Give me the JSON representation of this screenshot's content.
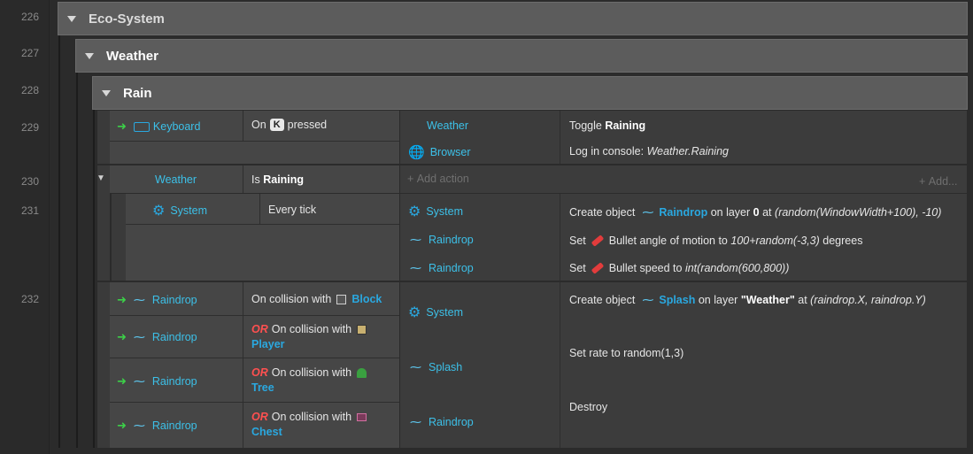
{
  "line_numbers": [
    "226",
    "227",
    "228",
    "229",
    "230",
    "231",
    "232"
  ],
  "groups": [
    {
      "name": "Eco-System"
    },
    {
      "name": "Weather"
    },
    {
      "name": "Rain"
    }
  ],
  "event229": {
    "object": "Keyboard",
    "cond_prefix": "On",
    "key": "K",
    "cond_suffix": "pressed",
    "actions": [
      {
        "object": "Weather",
        "text": "Toggle",
        "bold": "Raining"
      },
      {
        "object": "Browser",
        "text": "Log in console:",
        "italic": "Weather.Raining"
      }
    ]
  },
  "event230": {
    "object": "Weather",
    "cond_prefix": "Is",
    "bold": "Raining",
    "add_action": "Add action",
    "add": "Add..."
  },
  "event231": {
    "object": "System",
    "condition": "Every tick",
    "actions": [
      {
        "object": "System",
        "p1": "Create object",
        "obj": "Raindrop",
        "p2": "on layer",
        "b": "0",
        "p3": "at",
        "i": "(random(WindowWidth+100), -10)"
      },
      {
        "object": "Raindrop",
        "p1": "Set",
        "p2": "Bullet angle of motion to",
        "i": "100+random(-3,3)",
        "p3": "degrees"
      },
      {
        "object": "Raindrop",
        "p1": "Set",
        "p2": "Bullet speed to",
        "i": "int(random(600,800))"
      }
    ]
  },
  "event232": {
    "conditions": [
      {
        "object": "Raindrop",
        "or": "",
        "text": "On collision with",
        "target": "Block"
      },
      {
        "object": "Raindrop",
        "or": "OR",
        "text": "On collision with",
        "target": "Player"
      },
      {
        "object": "Raindrop",
        "or": "OR",
        "text": "On collision with",
        "target": "Tree"
      },
      {
        "object": "Raindrop",
        "or": "OR",
        "text": "On collision with",
        "target": "Chest"
      }
    ],
    "actions": [
      {
        "object": "System",
        "p1": "Create object",
        "obj": "Splash",
        "p2": "on layer",
        "b": "\"Weather\"",
        "p3": "at",
        "i": "(raindrop.X, raindrop.Y)"
      },
      {
        "object": "Splash",
        "text": "Set rate to random(1,3)"
      },
      {
        "object": "Raindrop",
        "text": "Destroy"
      }
    ]
  },
  "colors": {
    "object": "#3cc0e8",
    "or": "#ff5050",
    "trigger": "#3cd048",
    "group_header": "#5c5c5c"
  }
}
